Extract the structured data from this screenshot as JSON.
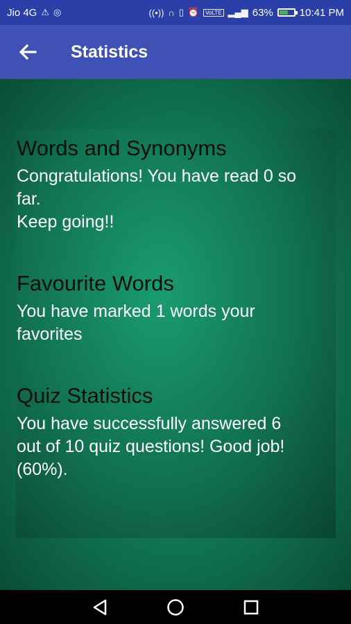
{
  "status_bar": {
    "carrier": "Jio 4G",
    "battery_percent": "63%",
    "battery_level": 0.63,
    "time": "10:41 PM",
    "volte": "VoLTE"
  },
  "app_bar": {
    "title": "Statistics"
  },
  "sections": [
    {
      "title": "Words and Synonyms",
      "text": "Congratulations! You have read 0 so\nfar.\nKeep going!!"
    },
    {
      "title": "Favourite Words",
      "text": "You have marked 1 words your\nfavorites"
    },
    {
      "title": "Quiz Statistics",
      "text": "You have successfully answered 6\nout of 10 quiz questions! Good job!\n(60%)."
    }
  ],
  "colors": {
    "status_bar": "#2b3fa8",
    "app_bar": "#3f51b5",
    "background": "#107652",
    "section_title": "#0a0f0c",
    "section_text": "#ffffff"
  }
}
